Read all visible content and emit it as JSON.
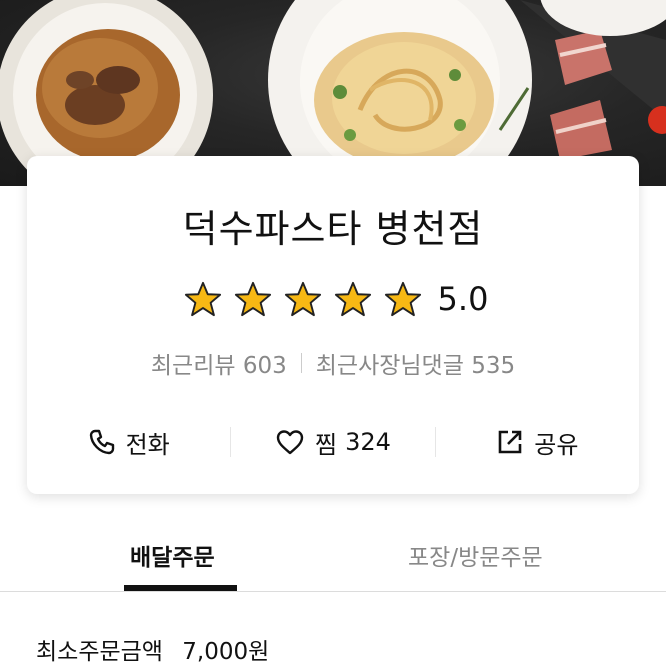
{
  "store": {
    "name": "덕수파스타 병천점",
    "rating": "5.0",
    "star_count": 5,
    "recent_reviews_label": "최근리뷰",
    "recent_reviews_count": "603",
    "owner_replies_label": "최근사장님댓글",
    "owner_replies_count": "535"
  },
  "actions": {
    "call_label": "전화",
    "favorite_label": "찜",
    "favorite_count": "324",
    "share_label": "공유"
  },
  "tabs": [
    {
      "label": "배달주문",
      "active": true
    },
    {
      "label": "포장/방문주문",
      "active": false
    }
  ],
  "order": {
    "min_order_label": "최소주문금액",
    "min_order_value": "7,000원"
  },
  "colors": {
    "star": "#f7b814",
    "accent": "#111111",
    "muted": "#888888"
  }
}
